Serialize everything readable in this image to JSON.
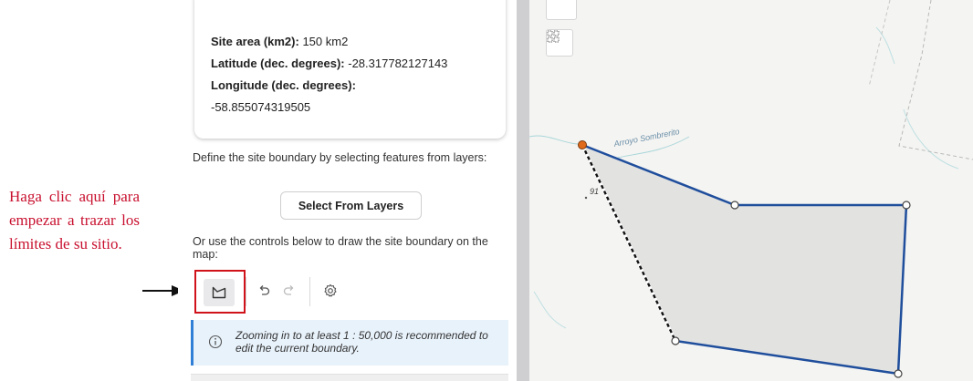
{
  "annotation": {
    "text": "Haga clic aquí para empezar a trazar los límites de su sitio."
  },
  "site_info": {
    "area_label": "Site area (km2):",
    "area_value": " 150 km2",
    "latitude_label": "Latitude (dec. degrees):",
    "latitude_value": " -28.317782127143",
    "longitude_label": "Longitude (dec. degrees):",
    "longitude_value": "-58.855074319505"
  },
  "boundary": {
    "define_text": "Define the site boundary by selecting features from layers:",
    "select_button_label": "Select From Layers",
    "controls_text": "Or use the controls below to draw the site boundary on the map:"
  },
  "notice": {
    "text": "Zooming in to at least 1 : 50,000 is recommended to edit the current boundary."
  },
  "map": {
    "stream_label": "Arroyo Sombrerito",
    "elevation_label": "91"
  },
  "colors": {
    "annotation": "#c8102e",
    "highlight_border": "#d0121b",
    "polygon_stroke": "#1f4e9c",
    "polygon_fill": "#dedede",
    "active_vertex": "#e06a1b",
    "notice_accent": "#2f7fd6"
  },
  "icons": {
    "draw_polygon": "draw-polygon-icon",
    "undo": "undo-icon",
    "redo": "redo-icon",
    "settings": "gear-icon",
    "info": "info-icon",
    "map_tool": "grid-select-icon",
    "arrow": "arrow-right-icon"
  }
}
